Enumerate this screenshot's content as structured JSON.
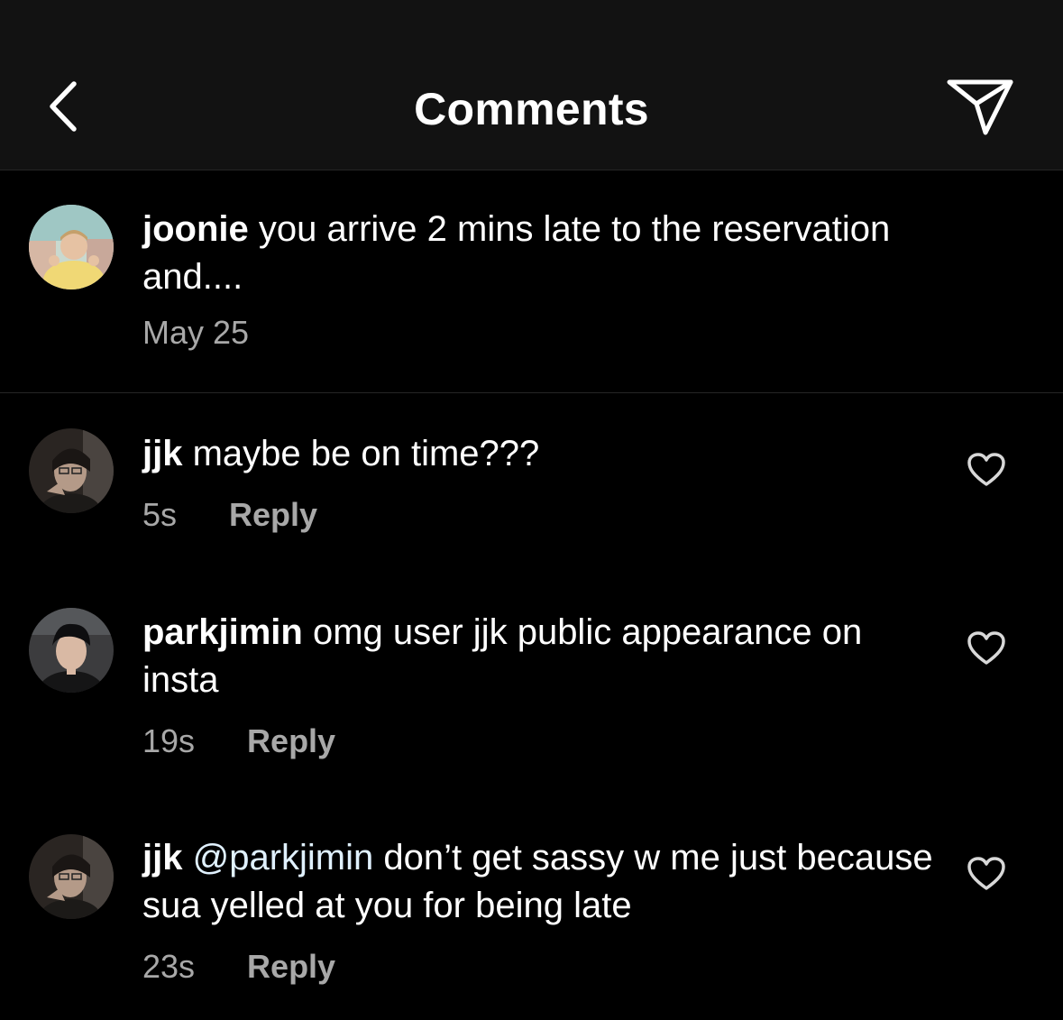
{
  "header": {
    "title": "Comments"
  },
  "caption": {
    "username": "joonie",
    "text": " you arrive 2 mins late to the reservation and....",
    "timestamp": "May 25"
  },
  "comments": [
    {
      "username": "jjk",
      "mention": "",
      "text": " maybe be on time???",
      "time": "5s",
      "reply_label": "Reply"
    },
    {
      "username": "parkjimin",
      "mention": "",
      "text": " omg user jjk public appearance on insta",
      "time": "19s",
      "reply_label": "Reply"
    },
    {
      "username": "jjk",
      "mention": " @parkjimin",
      "text": " don’t get sassy w me just because sua yelled at you for being late",
      "time": "23s",
      "reply_label": "Reply"
    }
  ],
  "colors": {
    "background": "#000000",
    "header_bg": "#121212",
    "secondary_text": "#a8a8a8",
    "mention": "#e0f1ff"
  },
  "icons": {
    "back": "chevron-left-icon",
    "send": "paper-plane-icon",
    "like": "heart-outline-icon"
  }
}
